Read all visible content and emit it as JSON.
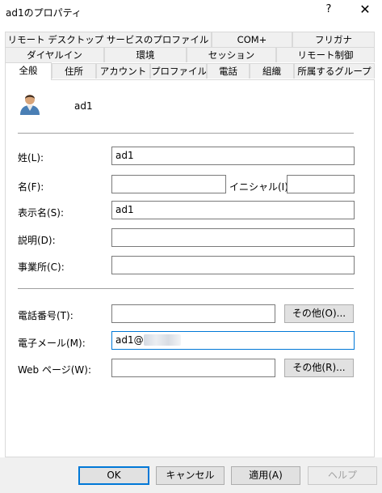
{
  "window": {
    "title": "ad1のプロパティ",
    "help_glyph": "?",
    "close_glyph": "✕"
  },
  "tabs": {
    "row1": [
      "リモート デスクトップ サービスのプロファイル",
      "COM+",
      "フリガナ"
    ],
    "row2": [
      "ダイヤルイン",
      "環境",
      "セッション",
      "リモート制御"
    ],
    "row3": [
      "全般",
      "住所",
      "アカウント",
      "プロファイル",
      "電話",
      "組織",
      "所属するグループ"
    ],
    "active": "全般"
  },
  "general": {
    "object_name": "ad1",
    "last_name": {
      "label": "姓(L):",
      "value": "ad1"
    },
    "first_name": {
      "label": "名(F):",
      "value": ""
    },
    "initials": {
      "label": "イニシャル(I):",
      "value": ""
    },
    "display_name": {
      "label": "表示名(S):",
      "value": "ad1"
    },
    "description": {
      "label": "説明(D):",
      "value": ""
    },
    "office": {
      "label": "事業所(C):",
      "value": ""
    },
    "telephone": {
      "label": "電話番号(T):",
      "value": "",
      "other_button": "その他(O)..."
    },
    "email": {
      "label": "電子メール(M):",
      "value": "ad1@"
    },
    "web_page": {
      "label": "Web ページ(W):",
      "value": "",
      "other_button": "その他(R)..."
    }
  },
  "footer": {
    "ok": "OK",
    "cancel": "キャンセル",
    "apply": "適用(A)",
    "help": "ヘルプ"
  },
  "colors": {
    "focus": "#0078d7",
    "face": "#f0f0f0",
    "button": "#e1e1e1"
  },
  "icons": {
    "user": "user-icon",
    "help": "help-icon",
    "close": "close-icon"
  }
}
